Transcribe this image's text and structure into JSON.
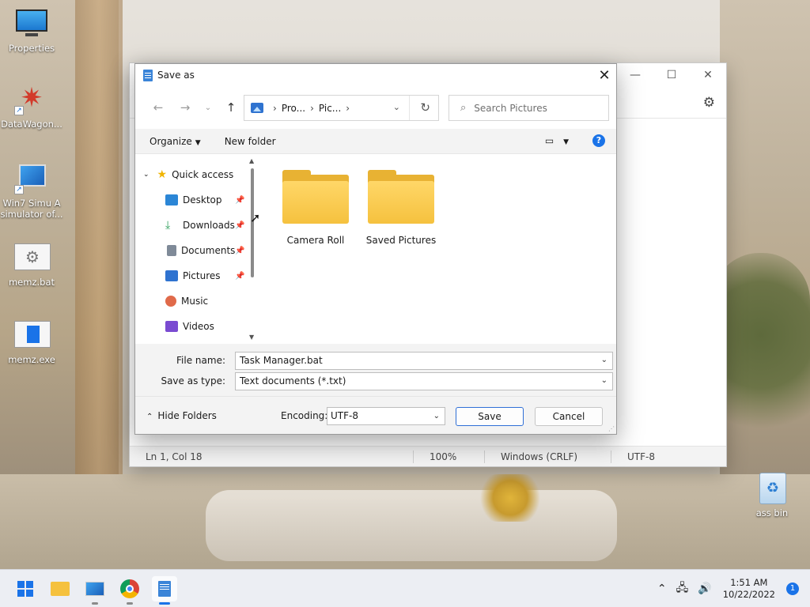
{
  "desktop": {
    "icons": [
      {
        "label": "Properties",
        "icon": "monitor-icon"
      },
      {
        "label": "DataWagon...",
        "icon": "star-logo-icon"
      },
      {
        "label": "Win7 Simu  A simulator of...",
        "icon": "win7-icon"
      },
      {
        "label": "memz.bat",
        "icon": "gear-file-icon"
      },
      {
        "label": "memz.exe",
        "icon": "blue-window-icon"
      },
      {
        "label": "ass bin",
        "icon": "recycle-bin-icon"
      }
    ]
  },
  "notepad": {
    "status": {
      "position": "Ln 1, Col 18",
      "zoom": "100%",
      "line_ending": "Windows (CRLF)",
      "encoding": "UTF-8"
    }
  },
  "dialog": {
    "title": "Save as",
    "address": {
      "seg1": "Pro...",
      "seg2": "Pic..."
    },
    "search_placeholder": "Search Pictures",
    "commands": {
      "organize": "Organize",
      "new_folder": "New folder",
      "help": "?"
    },
    "tree": {
      "quick_access": "Quick access",
      "items": [
        {
          "label": "Desktop",
          "pinned": true,
          "color": "#2b86d6"
        },
        {
          "label": "Downloads",
          "pinned": true,
          "color": "#2e9e5b"
        },
        {
          "label": "Documents",
          "pinned": true,
          "color": "#7f8a98"
        },
        {
          "label": "Pictures",
          "pinned": true,
          "color": "#2f73d0"
        },
        {
          "label": "Music",
          "pinned": false,
          "color": "#e06a4a"
        },
        {
          "label": "Videos",
          "pinned": false,
          "color": "#7a4bd1"
        }
      ]
    },
    "folders": [
      {
        "name": "Camera Roll"
      },
      {
        "name": "Saved Pictures"
      }
    ],
    "file_name_label": "File name:",
    "file_name_value": "Task Manager.bat",
    "save_type_label": "Save as type:",
    "save_type_value": "Text documents (*.txt)",
    "hide_folders": "Hide Folders",
    "encoding_label": "Encoding:",
    "encoding_value": "UTF-8",
    "save_button": "Save",
    "cancel_button": "Cancel"
  },
  "taskbar": {
    "time": "1:51 AM",
    "date": "10/22/2022",
    "notifications": "1"
  },
  "colors": {
    "accent": "#1a73e8",
    "folder": "#f5c13e"
  }
}
